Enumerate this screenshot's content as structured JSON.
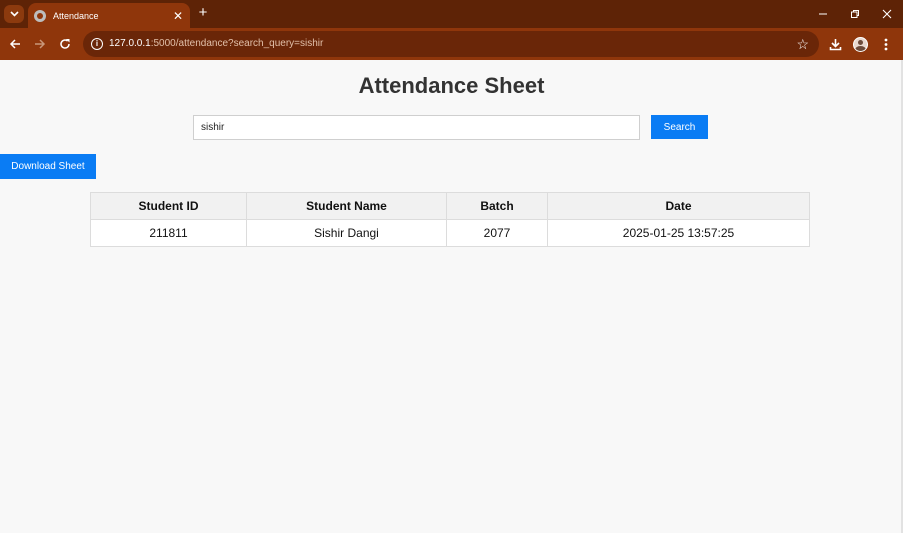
{
  "browser": {
    "tab_title": "Attendance",
    "new_tab_label": "+",
    "url_host": "127.0.0.1",
    "url_rest": ":5000/attendance?search_query=sishir",
    "icons": [
      "tab-menu-icon",
      "globe-icon",
      "close-icon",
      "plus-icon",
      "minimize-icon",
      "restore-icon",
      "close-window-icon",
      "back-icon",
      "forward-icon",
      "reload-icon",
      "info-icon",
      "star-icon",
      "download-icon",
      "avatar",
      "more-icon"
    ]
  },
  "page": {
    "title": "Attendance Sheet",
    "search": {
      "value": "sishir",
      "placeholder": ""
    },
    "search_button": "Search",
    "download_button": "Download Sheet",
    "accent_color": "#0a7cf4"
  },
  "table": {
    "headers": [
      "Student ID",
      "Student Name",
      "Batch",
      "Date"
    ],
    "rows": [
      [
        "211811",
        "Sishir Dangi",
        "2077",
        "2025-01-25 13:57:25"
      ]
    ]
  }
}
